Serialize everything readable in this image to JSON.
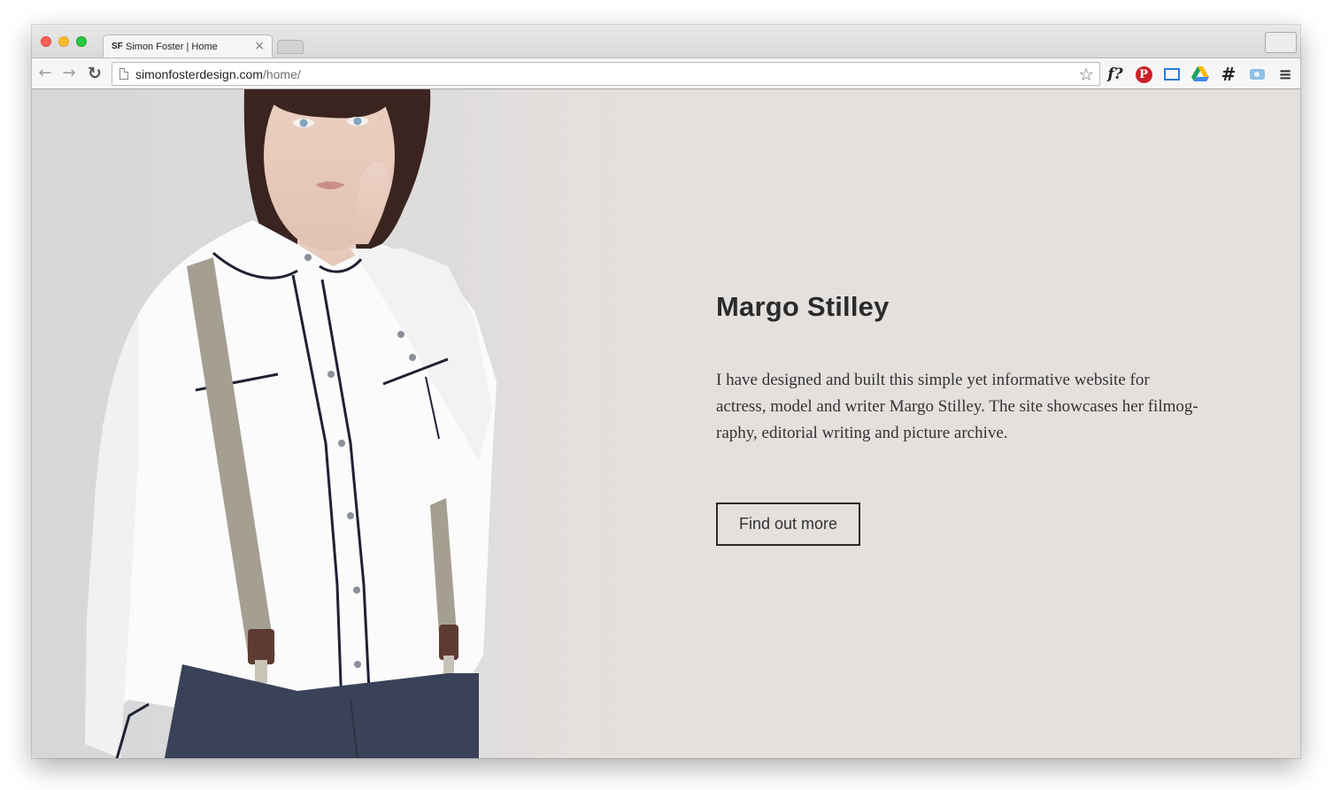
{
  "browser": {
    "tab": {
      "favicon_text": "SF",
      "title": "Simon Foster | Home",
      "close": "×"
    },
    "toolbar": {
      "back": "←",
      "forward": "→",
      "reload": "↻",
      "url_host": "simonfosterdesign.com",
      "url_path": "/home/",
      "bookmark_star": "☆"
    },
    "extensions": {
      "font": "f?",
      "pinterest": "P",
      "hash": "#",
      "menu": "≡"
    }
  },
  "page": {
    "heading": "Margo Stilley",
    "description_lines": [
      "I have designed and built this simple yet informative website for",
      "actress, model and writer Margo Stilley. The site showcases her filmog-",
      "raphy, editorial writing and picture archive."
    ],
    "cta_label": "Find out more"
  },
  "colors": {
    "page_background": "#e4e0de",
    "text": "#2b2b2b",
    "shirt": "#fbfbfb",
    "trousers": "#3a4258",
    "suspenders": "#a59f92"
  }
}
